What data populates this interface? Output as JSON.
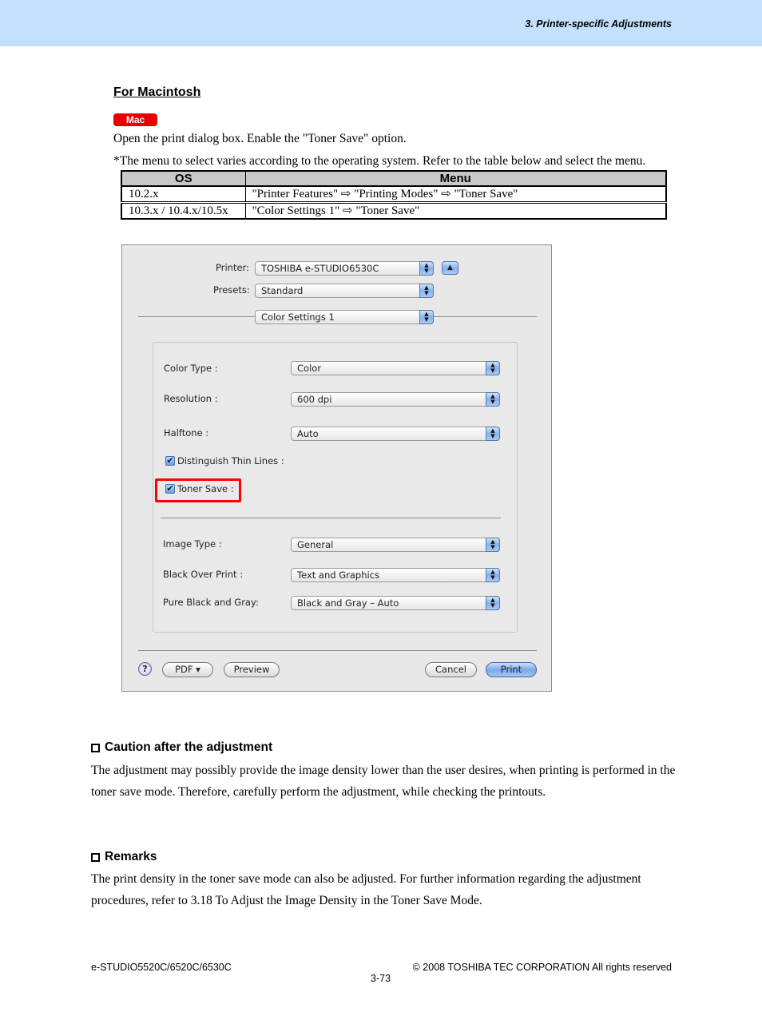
{
  "header": {
    "title": "3. Printer-specific Adjustments"
  },
  "section": {
    "heading": "For Macintosh",
    "badge": "Mac",
    "intro": "Open the print dialog box.  Enable the \"Toner Save\" option.",
    "note": "*The menu to select varies according to the operating system.  Refer to the table below and select the menu."
  },
  "os_table": {
    "headers": [
      "OS",
      "Menu"
    ],
    "rows": [
      {
        "os": "10.2.x",
        "menu": "\"Printer Features\" ⇨ \"Printing Modes\" ⇨ \"Toner Save\""
      },
      {
        "os": "10.3.x / 10.4.x/10.5x",
        "menu": "\"Color Settings 1\" ⇨ \"Toner Save\""
      }
    ]
  },
  "dialog": {
    "printer_label": "Printer:",
    "printer_value": "TOSHIBA e-STUDIO6530C",
    "presets_label": "Presets:",
    "presets_value": "Standard",
    "panel_value": "Color Settings 1",
    "stepper_glyph": "▲\n▼",
    "collapse_glyph": "▲",
    "fields": [
      {
        "label": "Color Type :",
        "value": "Color"
      },
      {
        "label": "Resolution :",
        "value": "600 dpi"
      },
      {
        "label": "Halftone :",
        "value": "Auto"
      }
    ],
    "checkboxes": [
      {
        "label": "Distinguish Thin Lines :",
        "checked": true
      },
      {
        "label": "Toner Save :",
        "checked": true
      }
    ],
    "check_glyph": "✔",
    "fields2": [
      {
        "label": "Image Type :",
        "value": "General"
      },
      {
        "label": "Black Over Print :",
        "value": "Text and Graphics"
      },
      {
        "label": "Pure Black and Gray:",
        "value": "Black and Gray – Auto"
      }
    ],
    "help_glyph": "?",
    "buttons": {
      "pdf": "PDF ▾",
      "preview": "Preview",
      "cancel": "Cancel",
      "print": "Print"
    }
  },
  "caution": {
    "heading": "Caution after the adjustment",
    "text": "The adjustment may possibly provide the image density lower than the user desires, when printing is performed in the toner save mode.  Therefore, carefully perform the adjustment, while checking the printouts."
  },
  "remarks": {
    "heading": "Remarks",
    "text": "The print density in the toner save mode can also be adjusted.  For further information regarding the adjustment procedures, refer to 3.18 To Adjust the Image Density in the Toner Save Mode."
  },
  "footer": {
    "model": "e-STUDIO5520C/6520C/6530C",
    "copyright": "© 2008 TOSHIBA TEC CORPORATION All rights reserved",
    "page": "3-73"
  }
}
